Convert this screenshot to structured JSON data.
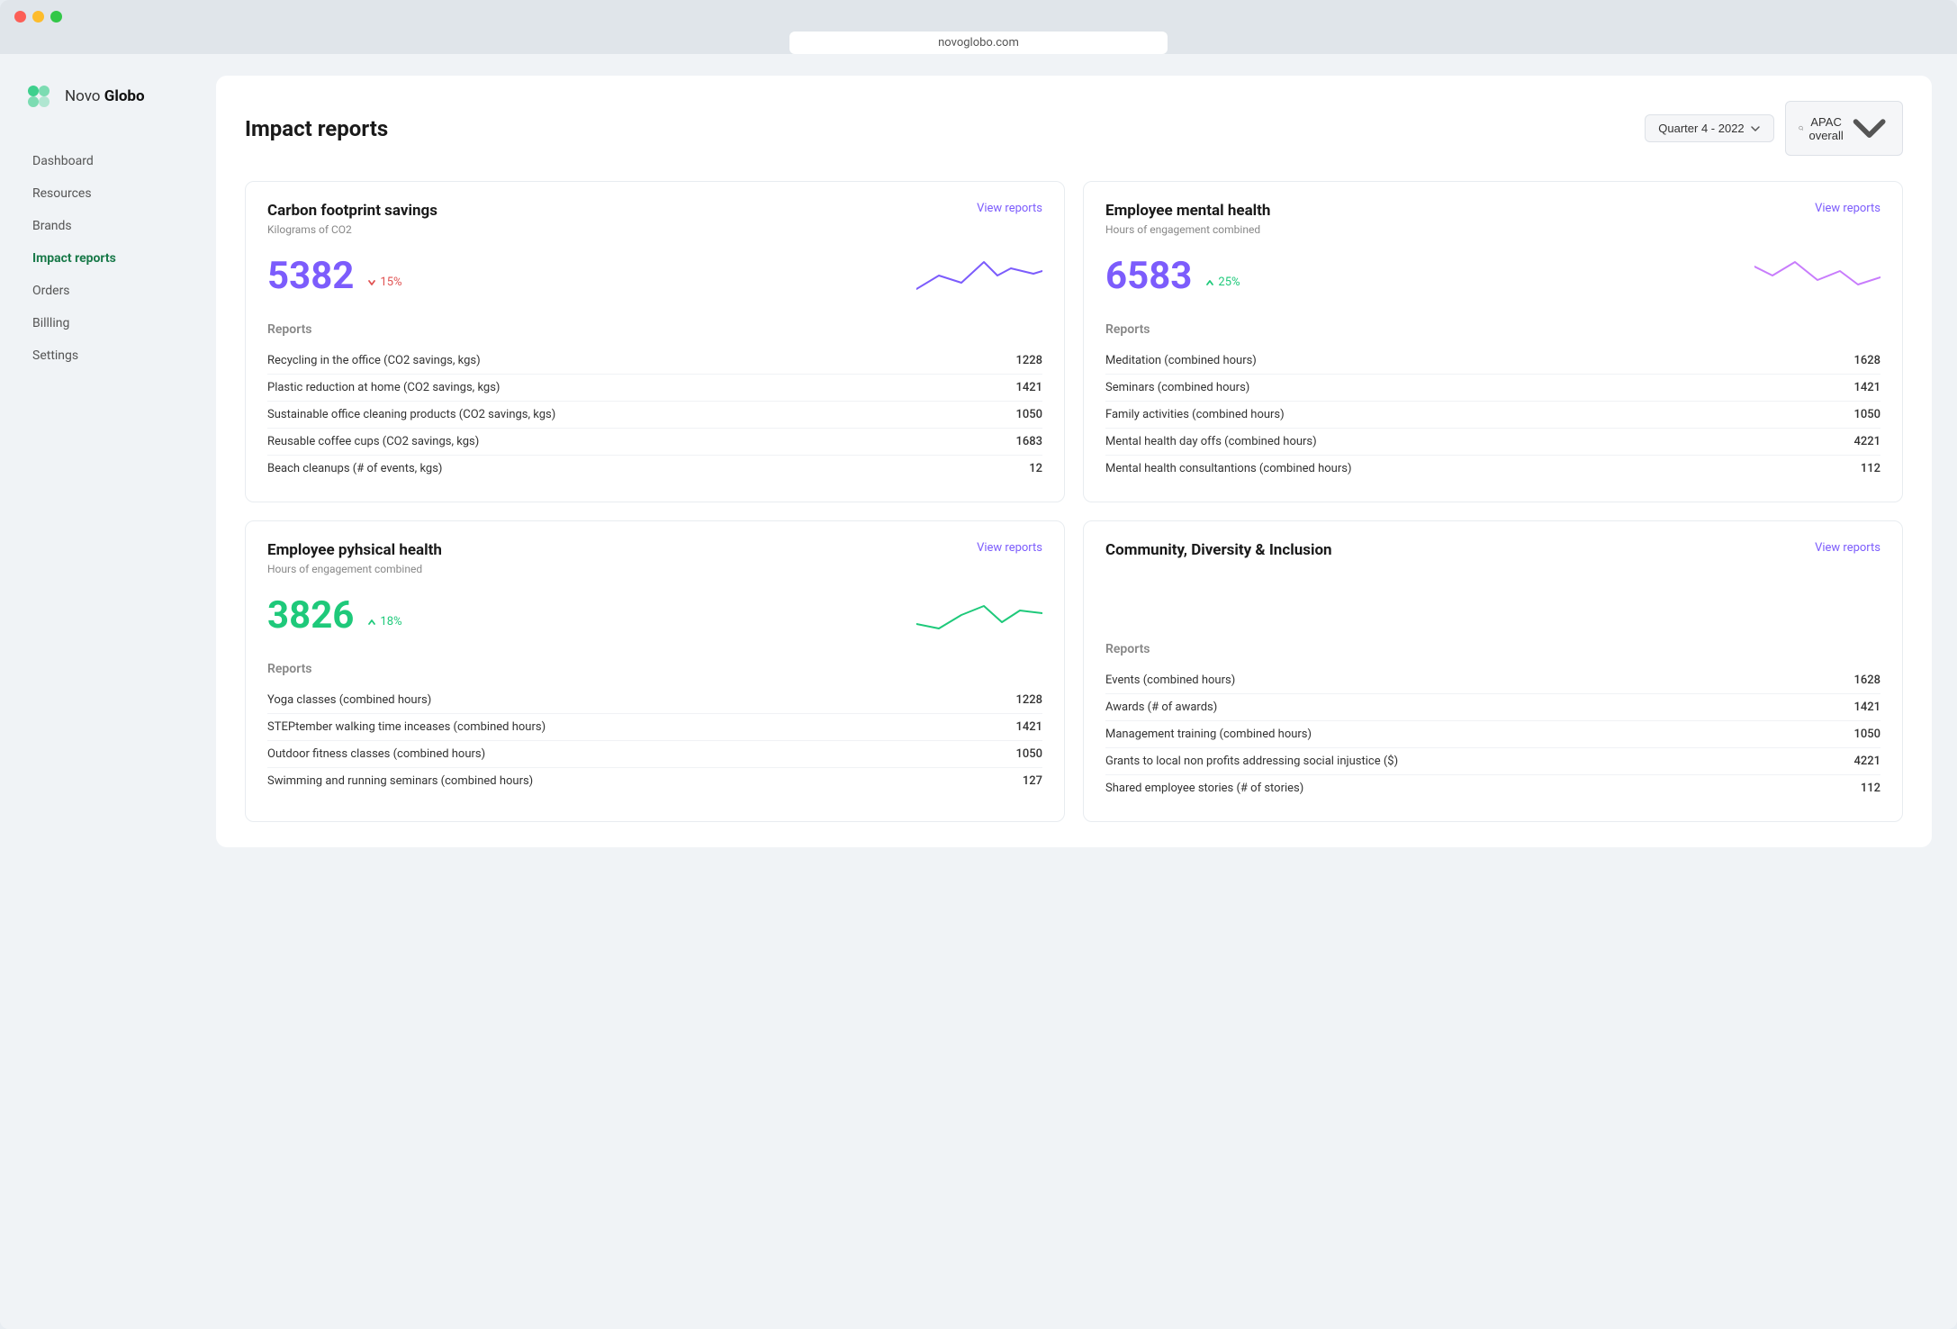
{
  "browser": {
    "url": "novoglobo.com"
  },
  "logo": {
    "company": "Novo",
    "company_bold": "Globo"
  },
  "nav": {
    "items": [
      {
        "label": "Dashboard",
        "id": "dashboard",
        "active": false
      },
      {
        "label": "Resources",
        "id": "resources",
        "active": false
      },
      {
        "label": "Brands",
        "id": "brands",
        "active": false
      },
      {
        "label": "Impact reports",
        "id": "impact-reports",
        "active": true
      },
      {
        "label": "Orders",
        "id": "orders",
        "active": false
      },
      {
        "label": "Billling",
        "id": "billing",
        "active": false
      },
      {
        "label": "Settings",
        "id": "settings",
        "active": false
      }
    ]
  },
  "page": {
    "title": "Impact reports",
    "quarter_filter": "Quarter 4 - 2022",
    "region_filter": "APAC overall"
  },
  "cards": {
    "carbon": {
      "title": "Carbon footprint savings",
      "subtitle": "Kilograms of CO2",
      "view_link": "View reports",
      "metric": "5382",
      "change": "15%",
      "change_direction": "down",
      "reports_title": "Reports",
      "rows": [
        {
          "label": "Recycling in the office (CO2 savings, kgs)",
          "value": "1228"
        },
        {
          "label": "Plastic reduction at home (CO2 savings, kgs)",
          "value": "1421"
        },
        {
          "label": "Sustainable office cleaning products (CO2 savings, kgs)",
          "value": "1050"
        },
        {
          "label": "Reusable coffee cups (CO2 savings, kgs)",
          "value": "1683"
        },
        {
          "label": "Beach cleanups (# of events, kgs)",
          "value": "12"
        }
      ]
    },
    "mental_health": {
      "title": "Employee mental health",
      "subtitle": "Hours of engagement combined",
      "view_link": "View reports",
      "metric": "6583",
      "change": "25%",
      "change_direction": "up",
      "reports_title": "Reports",
      "rows": [
        {
          "label": "Meditation (combined hours)",
          "value": "1628"
        },
        {
          "label": "Seminars (combined hours)",
          "value": "1421"
        },
        {
          "label": "Family activities (combined hours)",
          "value": "1050"
        },
        {
          "label": "Mental health day offs (combined hours)",
          "value": "4221"
        },
        {
          "label": "Mental health consultantions (combined hours)",
          "value": "112"
        }
      ]
    },
    "physical_health": {
      "title": "Employee pyhsical health",
      "subtitle": "Hours of engagement combined",
      "view_link": "View reports",
      "metric": "3826",
      "change": "18%",
      "change_direction": "up",
      "reports_title": "Reports",
      "rows": [
        {
          "label": "Yoga classes (combined hours)",
          "value": "1228"
        },
        {
          "label": "STEPtember walking time inceases (combined hours)",
          "value": "1421"
        },
        {
          "label": "Outdoor fitness classes (combined hours)",
          "value": "1050"
        },
        {
          "label": "Swimming and running seminars (combined hours)",
          "value": "127"
        }
      ]
    },
    "community": {
      "title": "Community, Diversity & Inclusion",
      "subtitle": "",
      "view_link": "View reports",
      "reports_title": "Reports",
      "rows": [
        {
          "label": "Events (combined hours)",
          "value": "1628"
        },
        {
          "label": "Awards (# of awards)",
          "value": "1421"
        },
        {
          "label": "Management training (combined hours)",
          "value": "1050"
        },
        {
          "label": "Grants to local non profits addressing social injustice ($)",
          "value": "4221"
        },
        {
          "label": "Shared employee stories (# of stories)",
          "value": "112"
        }
      ]
    }
  },
  "icons": {
    "chevron_down": "▾",
    "search": "🔍",
    "arrow_up": "↗",
    "arrow_down": "↘"
  }
}
